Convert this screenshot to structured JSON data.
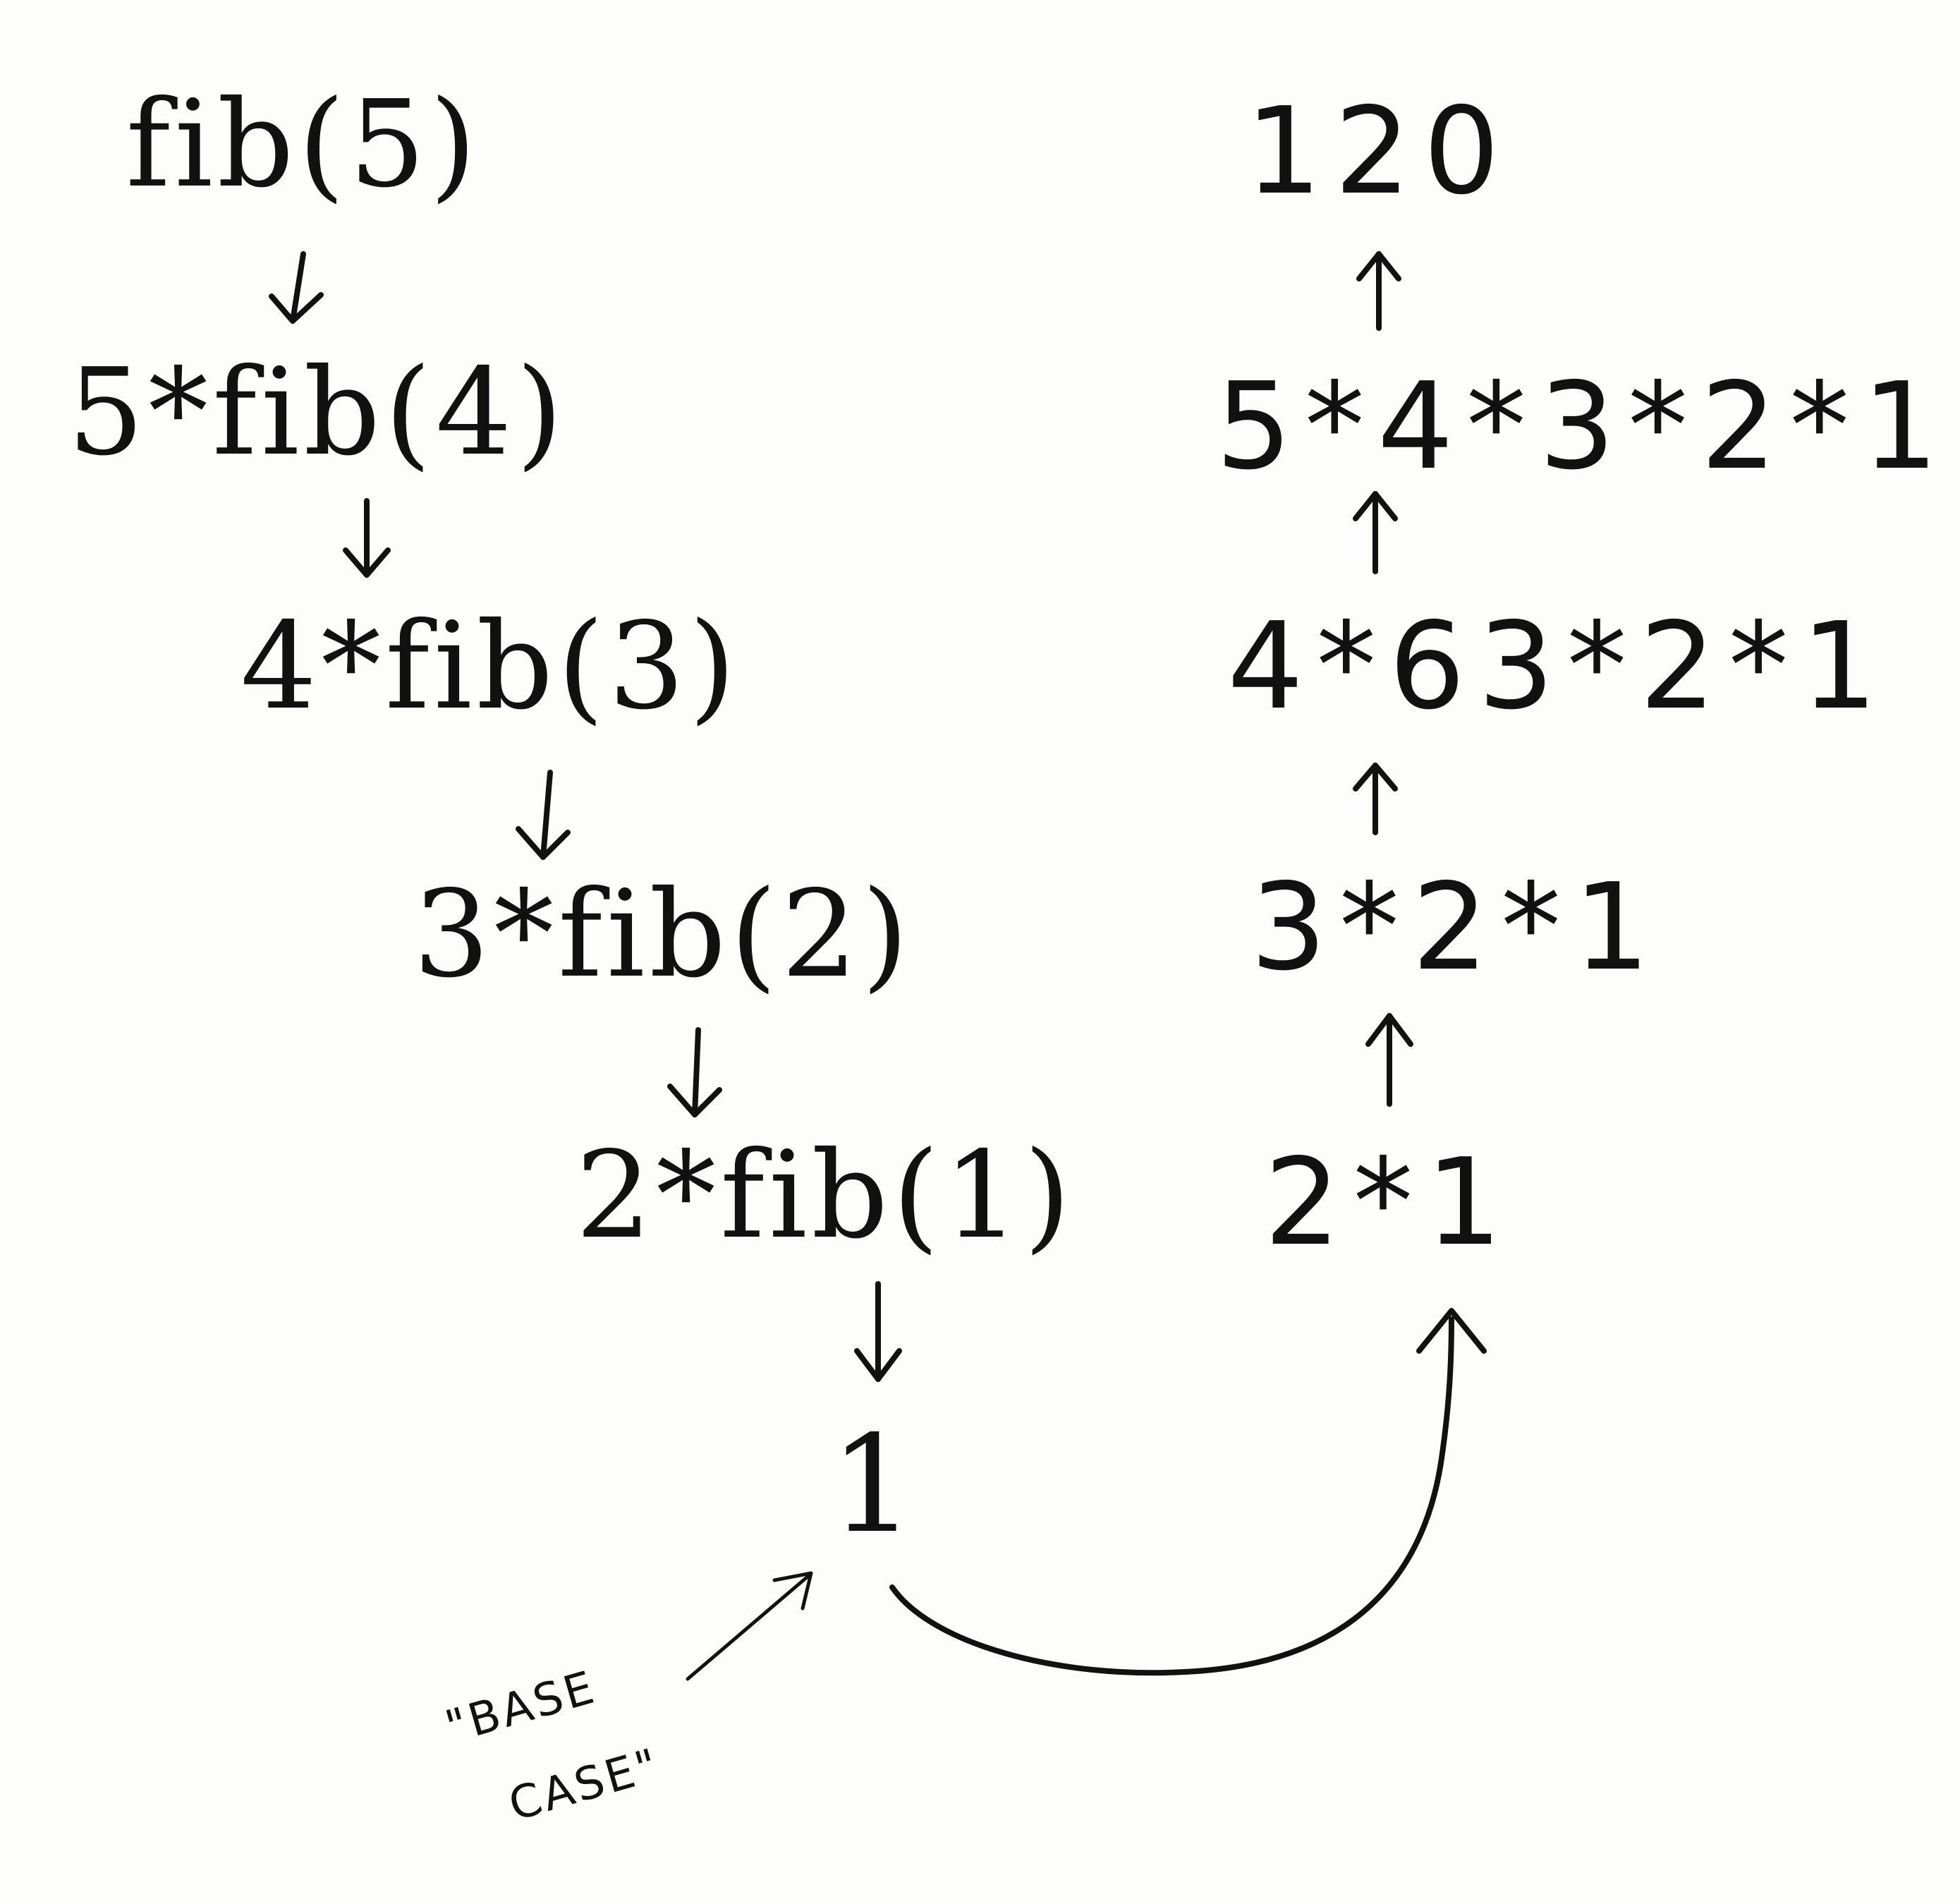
{
  "descent": {
    "steps": [
      "fib(5)",
      "5*fib(4)",
      "4*fib(3)",
      "3*fib(2)",
      "2*fib(1)"
    ],
    "base_value": "1"
  },
  "ascent": {
    "steps": [
      "2*1",
      "3*2*1",
      "4*63*2*1",
      "5*4*3*2*1",
      "120"
    ]
  },
  "annotation": {
    "line1": "\"BASE",
    "line2": "CASE\""
  }
}
